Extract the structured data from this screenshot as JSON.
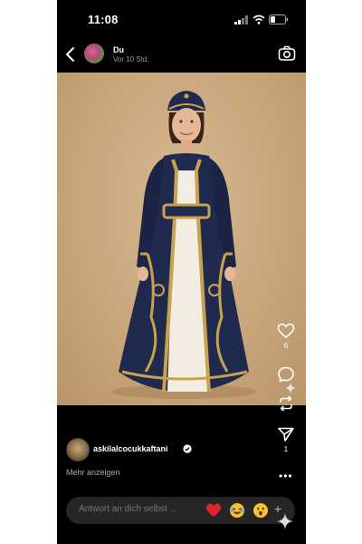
{
  "status": {
    "time": "11:08"
  },
  "story": {
    "user": "Du",
    "posted": "Vor 10 Std."
  },
  "actions": {
    "like_count": "6",
    "share_count": "1"
  },
  "author": {
    "name": "askilalcocukkaftani",
    "more": "Mehr anzeigen"
  },
  "reply": {
    "placeholder": "Antwort an dich selbst ..."
  },
  "icons": [
    "back-icon",
    "camera-icon",
    "heart-icon",
    "comment-icon",
    "repost-icon",
    "send-icon",
    "more-icon",
    "verified-icon"
  ],
  "colors": {
    "background": "#000000",
    "photo_backdrop": "#c9a67c",
    "dress": "#1f2a4e",
    "embroidery": "#c9a24e"
  }
}
